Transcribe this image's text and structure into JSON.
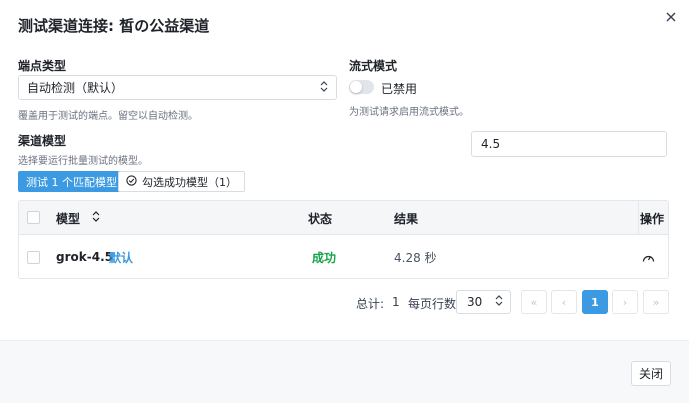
{
  "dialog": {
    "title": "测试渠道连接: 皙の公益渠道",
    "close_icon": "close-icon"
  },
  "endpoint": {
    "label": "端点类型",
    "value": "自动检测（默认）",
    "hint": "覆盖用于测试的端点。留空以自动检测。"
  },
  "stream": {
    "label": "流式模式",
    "state_label": "已禁用",
    "hint": "为测试请求启用流式模式。",
    "enabled": false
  },
  "models": {
    "label": "渠道模型",
    "hint": "选择要运行批量测试的模型。",
    "filter_value": "4.5",
    "test_button": "测试 1 个匹配模型",
    "select_success_button": "勾选成功模型（1）"
  },
  "table": {
    "headers": {
      "model": "模型",
      "status": "状态",
      "result": "结果",
      "action": "操作"
    },
    "rows": [
      {
        "model": "grok-4.5",
        "tag": "默认",
        "status": "成功",
        "result": "4.28 秒"
      }
    ]
  },
  "pagination": {
    "total_label": "总计:",
    "total": "1",
    "per_page_label": "每页行数",
    "page_size": "30",
    "first": "«",
    "prev": "‹",
    "current": "1",
    "next": "›",
    "last": "»"
  },
  "footer": {
    "close_button": "关闭"
  },
  "colors": {
    "accent": "#3b9ae1",
    "success": "#16a34a",
    "muted": "#6b7280"
  }
}
